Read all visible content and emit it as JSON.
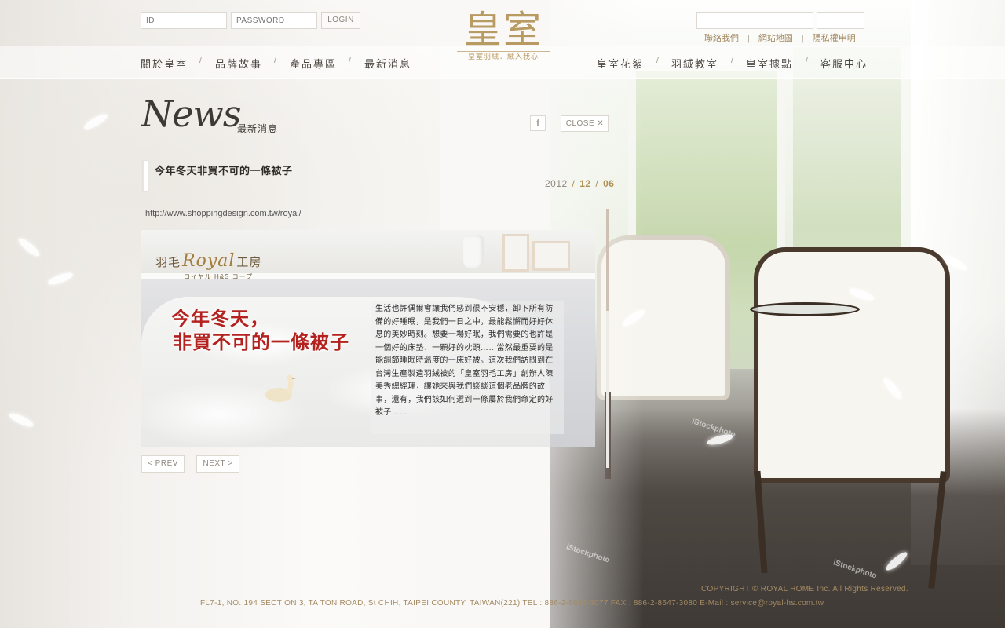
{
  "login": {
    "id_placeholder": "ID",
    "password_placeholder": "PASSWORD",
    "login_label": "LOGIN"
  },
  "utility_links": [
    "聯絡我們",
    "網站地圖",
    "隱私權申明"
  ],
  "logo": {
    "main": "皇室",
    "tagline": "皇室羽絨．絨入我心"
  },
  "nav_left": [
    "關於皇室",
    "品牌故事",
    "產品專區",
    "最新消息"
  ],
  "nav_right": [
    "皇室花絮",
    "羽絨教室",
    "皇室據點",
    "客服中心"
  ],
  "nav_separator": "/",
  "section": {
    "title": "News",
    "subtitle": "最新消息"
  },
  "actions": {
    "facebook_icon": "f",
    "close_label": "CLOSE ✕"
  },
  "article": {
    "title": "今年冬天非買不可的一條被子",
    "date_year": "2012",
    "date_month": "12",
    "date_day": "06",
    "link": "http://www.shoppingdesign.com.tw/royal/",
    "banner": {
      "brand_cn_left": "羽毛",
      "brand_script": "Royal",
      "brand_cn_right": "工房",
      "brand_jp": "ロイヤル H&S コープ",
      "headline_line1": "今年冬天，",
      "headline_line2": "非買不可的一條被子",
      "body": "生活也許偶爾會讓我們感到很不安穩，卸下所有防備的好睡眠，是我們一日之中，最能鬆懈而好好休息的美妙時刻。想要一場好眠，我們需要的也許是一個好的床墊、一顆好的枕頭……當然最重要的是能調節睡眠時溫度的一床好被。這次我們訪問到在台灣生產製造羽絨被的「皇室羽毛工房」創辦人陳美秀總經理，讓她來與我們談談這個老品牌的故事，還有，我們該如何選到一條屬於我們命定的好被子……"
    }
  },
  "pager": {
    "prev_label": "< PREV",
    "next_label": "NEXT >"
  },
  "footer": {
    "copyright": "COPYRIGHT © ROYAL HOME Inc. All Rights Reserved.",
    "address": "FL7-1, NO. 194 SECTION 3, TA TON ROAD, St CHIH, TAIPEI COUNTY, TAIWAN(221)   TEL : 886-2-8647-3077   FAX : 886-2-8647-3080   E-Mail : service@royal-hs.com.tw"
  },
  "watermark_text": "iStockphoto",
  "colors": {
    "gold": "#b89a63",
    "accent_date": "#b08f52",
    "headline_red": "#b3221f"
  }
}
